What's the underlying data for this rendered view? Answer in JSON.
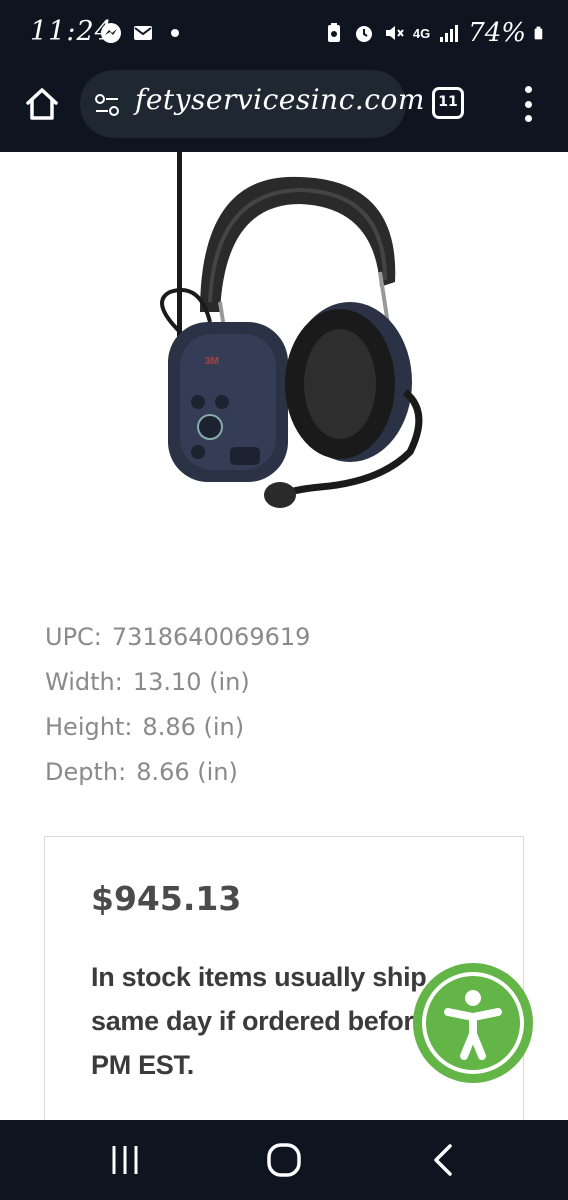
{
  "status_bar": {
    "time": "11:24",
    "battery": "74%",
    "network": "4G",
    "icons": [
      "messenger-icon",
      "mail-icon",
      "dot-icon",
      "battery-saver-icon",
      "alarm-icon",
      "mute-icon",
      "signal-icon",
      "battery-icon"
    ]
  },
  "browser": {
    "url": "fetyservicesinc.com",
    "tab_count": "11",
    "icons": [
      "home-icon",
      "site-settings-icon",
      "tabs-icon",
      "more-vert-icon"
    ]
  },
  "product": {
    "image_icon": "headset-image",
    "specs": [
      {
        "label": "UPC:",
        "value": "7318640069619"
      },
      {
        "label": "Width:",
        "value": "13.10 (in)"
      },
      {
        "label": "Height:",
        "value": "8.86 (in)"
      },
      {
        "label": "Depth:",
        "value": "8.66 (in)"
      }
    ]
  },
  "purchase": {
    "price": "$945.13",
    "stock_lines": [
      "In stock items usually ship",
      "same day if ordered before",
      "PM EST."
    ]
  },
  "accessibility": {
    "icon": "accessibility-icon",
    "color": "#62b546"
  },
  "nav_bar": {
    "icons": [
      "recents-icon",
      "home-circle-icon",
      "back-icon"
    ]
  },
  "colors": {
    "system_bar": "#0e1521",
    "url_pill": "#1f2733",
    "spec_text": "#8a8a8a",
    "price_text": "#4b4b4b"
  }
}
